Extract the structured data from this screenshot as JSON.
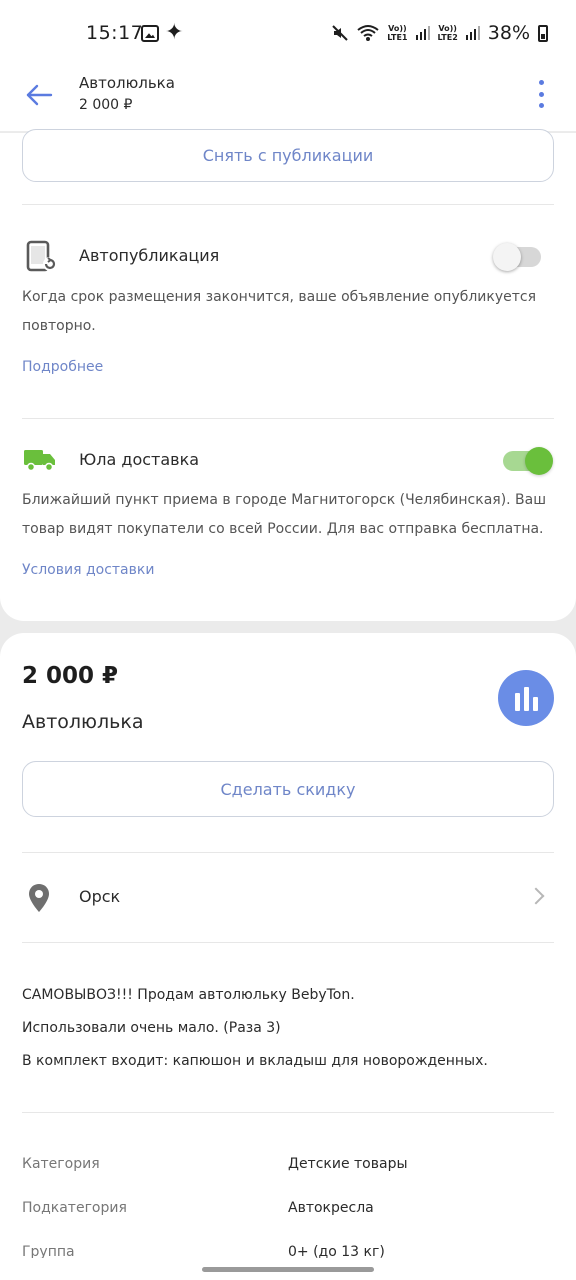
{
  "status_bar": {
    "time": "15:17",
    "battery": "38%",
    "sim1": "Vo)) LTE1",
    "sim2": "Vo)) LTE2",
    "icons": [
      "gallery-icon",
      "sparkle-icon",
      "mute-icon",
      "wifi-icon",
      "signal-icon",
      "battery-icon"
    ]
  },
  "header": {
    "title": "Автолюлька",
    "price": "2 000 ₽",
    "back_icon": "arrow-left-icon",
    "menu_icon": "more-vertical-icon",
    "accent": "#5b7be0"
  },
  "card1": {
    "unpublish_button": "Снять с публикации",
    "autopublish": {
      "title": "Автопубликация",
      "enabled": false,
      "description": "Когда срок размещения закончится, ваше объявление опубликуется повторно.",
      "link": "Подробнее",
      "icon": "device-refresh-icon"
    },
    "delivery": {
      "title": "Юла доставка",
      "enabled": true,
      "description": "Ближайший пункт приема в городе Магнитогорск (Челябинская). Ваш товар видят покупатели со всей России. Для вас отправка бесплатна.",
      "link": "Условия доставки",
      "icon": "delivery-truck-icon",
      "icon_color": "#6abf3c"
    }
  },
  "card2": {
    "price": "2 000 ₽",
    "name": "Автолюлька",
    "stats_icon": "bar-chart-icon",
    "discount_button": "Сделать скидку",
    "location": {
      "city": "Орск",
      "icon": "map-pin-icon"
    },
    "description_lines": [
      "САМОВЫВОЗ!!! Продам автолюльку BebyTon.",
      "Использовали очень мало. (Раза 3)",
      "В комплект входит: капюшон и вкладыш для новорожденных."
    ],
    "attributes": [
      {
        "label": "Категория",
        "value": "Детские товары"
      },
      {
        "label": "Подкатегория",
        "value": "Автокресла"
      },
      {
        "label": "Группа",
        "value": "0+ (до 13 кг)"
      }
    ]
  }
}
